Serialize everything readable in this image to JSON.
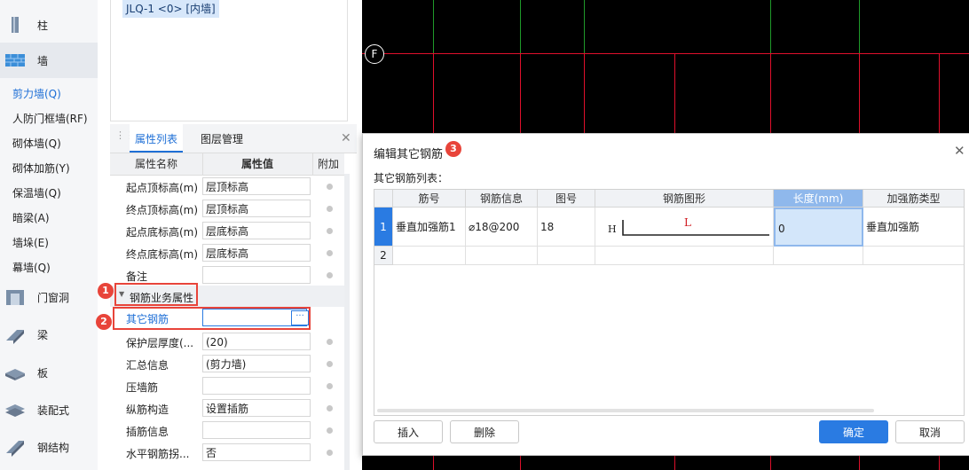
{
  "nav": {
    "categories": [
      {
        "label": "柱",
        "icon": "column-icon"
      },
      {
        "label": "墙",
        "icon": "wall-icon"
      },
      {
        "label": "门窗洞",
        "icon": "door-window-icon"
      },
      {
        "label": "梁",
        "icon": "beam-icon"
      },
      {
        "label": "板",
        "icon": "slab-icon"
      },
      {
        "label": "装配式",
        "icon": "prefab-icon"
      },
      {
        "label": "钢结构",
        "icon": "steel-structure-icon"
      }
    ],
    "wall_items": [
      "剪力墙(Q)",
      "人防门框墙(RF)",
      "砌体墙(Q)",
      "砌体加筋(Y)",
      "保温墙(Q)",
      "暗梁(A)",
      "墙垛(E)",
      "幕墙(Q)"
    ]
  },
  "tree": {
    "item": "JLQ-1 <0> [内墙]"
  },
  "props": {
    "tabs": [
      "属性列表",
      "图层管理"
    ],
    "headers": {
      "name": "属性名称",
      "value": "属性值",
      "extra": "附加"
    },
    "rows_top": [
      {
        "name": "起点顶标高(m)",
        "value": "层顶标高"
      },
      {
        "name": "终点顶标高(m)",
        "value": "层顶标高"
      },
      {
        "name": "起点底标高(m)",
        "value": "层底标高"
      },
      {
        "name": "终点底标高(m)",
        "value": "层底标高"
      },
      {
        "name": "备注",
        "value": ""
      }
    ],
    "group": "钢筋业务属性",
    "selected": {
      "name": "其它钢筋",
      "value": "",
      "button": "···"
    },
    "rows_bottom": [
      {
        "name": "保护层厚度(...",
        "value": "(20)"
      },
      {
        "name": "汇总信息",
        "value": "(剪力墙)"
      },
      {
        "name": "压墙筋",
        "value": ""
      },
      {
        "name": "纵筋构造",
        "value": "设置插筋"
      },
      {
        "name": "插筋信息",
        "value": ""
      },
      {
        "name": "水平钢筋拐...",
        "value": "否"
      }
    ]
  },
  "cad": {
    "axis_label": "F",
    "colors": {
      "grid_red": "#e0102c",
      "grid_green": "#1f9a2a"
    }
  },
  "dialog": {
    "title": "编辑其它钢筋",
    "list_label": "其它钢筋列表：",
    "columns": [
      "筋号",
      "钢筋信息",
      "图号",
      "钢筋图形",
      "长度(mm)",
      "加强筋类型"
    ],
    "rows": [
      {
        "num": "1",
        "name": "垂直加强筋1",
        "info": "⌀18@200",
        "fig": "18",
        "shape_left": "H",
        "shape_mid": "L",
        "length": "0",
        "type": "垂直加强筋"
      },
      {
        "num": "2",
        "name": "",
        "info": "",
        "fig": "",
        "shape_left": "",
        "shape_mid": "",
        "length": "",
        "type": ""
      }
    ],
    "buttons": {
      "insert": "插入",
      "delete": "删除",
      "ok": "确定",
      "cancel": "取消"
    }
  },
  "markers": [
    "1",
    "2",
    "3"
  ],
  "colors": {
    "accent": "#2a7be2",
    "marker": "#e8443a",
    "selected_header": "#8fb8ec"
  }
}
